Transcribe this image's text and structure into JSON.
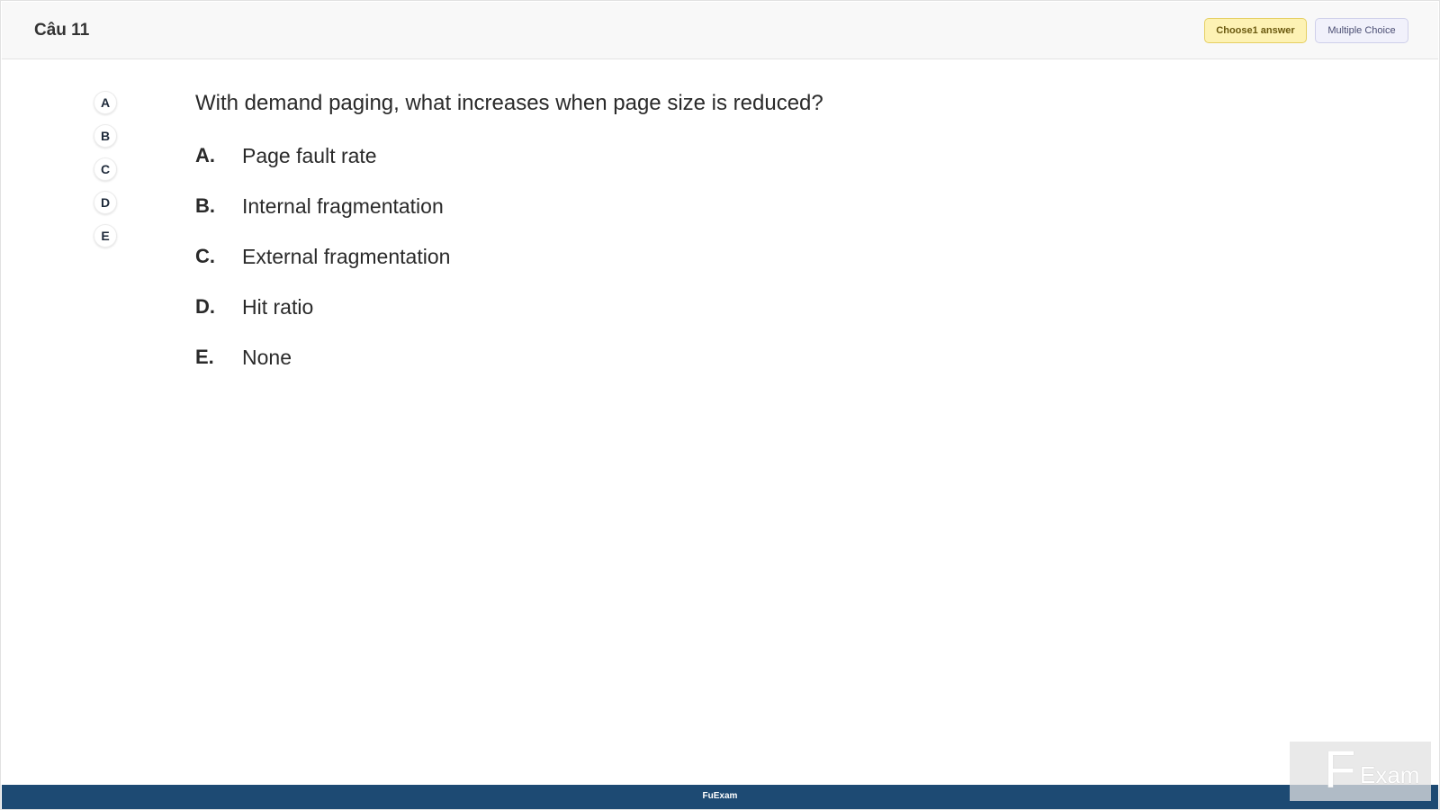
{
  "header": {
    "title": "Câu 11",
    "badge_choose": "Choose1 answer",
    "badge_type": "Multiple Choice"
  },
  "letter_nav": [
    "A",
    "B",
    "C",
    "D",
    "E"
  ],
  "question": {
    "text": "With demand paging, what increases when page size is reduced?",
    "options": [
      {
        "key": "A.",
        "text": "Page fault rate"
      },
      {
        "key": "B.",
        "text": "Internal fragmentation"
      },
      {
        "key": "C.",
        "text": "External fragmentation"
      },
      {
        "key": "D.",
        "text": "Hit ratio"
      },
      {
        "key": "E.",
        "text": "None"
      }
    ]
  },
  "footer": {
    "text": "FuExam"
  },
  "watermark": {
    "mark": "F",
    "text": "Exam"
  },
  "colors": {
    "footer_bg": "#1d4a73",
    "badge_choose_bg": "#fdf2b4",
    "badge_type_bg": "#f1f1fb"
  }
}
